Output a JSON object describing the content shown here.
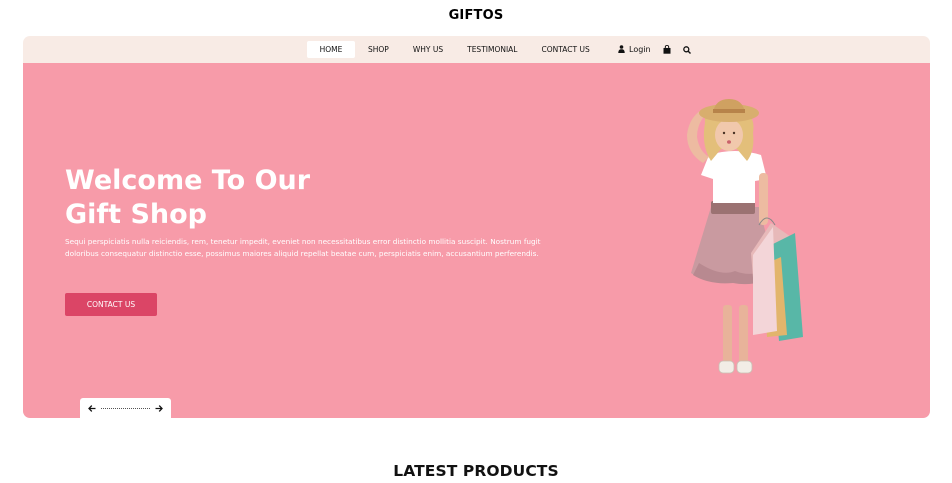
{
  "brand": "GIFTOS",
  "nav": {
    "links": [
      "HOME",
      "SHOP",
      "WHY US",
      "TESTIMONIAL",
      "CONTACT US"
    ],
    "active_index": 0,
    "login_label": "Login",
    "icons": [
      "user-icon",
      "shopping-bag-icon",
      "search-icon"
    ]
  },
  "hero": {
    "title_line1": "Welcome To Our",
    "title_line2": "Gift Shop",
    "text": "Sequi perspiciatis nulla reiciendis, rem, tenetur impedit, eveniet non necessitatibus error distinctio mollitia suscipit. Nostrum fugit doloribus consequatur distinctio esse, possimus maiores aliquid repellat beatae cum, perspiciatis enim, accusantium perferendis.",
    "button_label": "CONTACT US"
  },
  "carousel": {
    "icons": [
      "arrow-left-icon",
      "arrow-right-icon"
    ]
  },
  "section": {
    "title": "LATEST PRODUCTS"
  },
  "colors": {
    "hero_bg": "#f79ba9",
    "navbar_bg": "#f8ebe5",
    "accent": "#db4566"
  }
}
